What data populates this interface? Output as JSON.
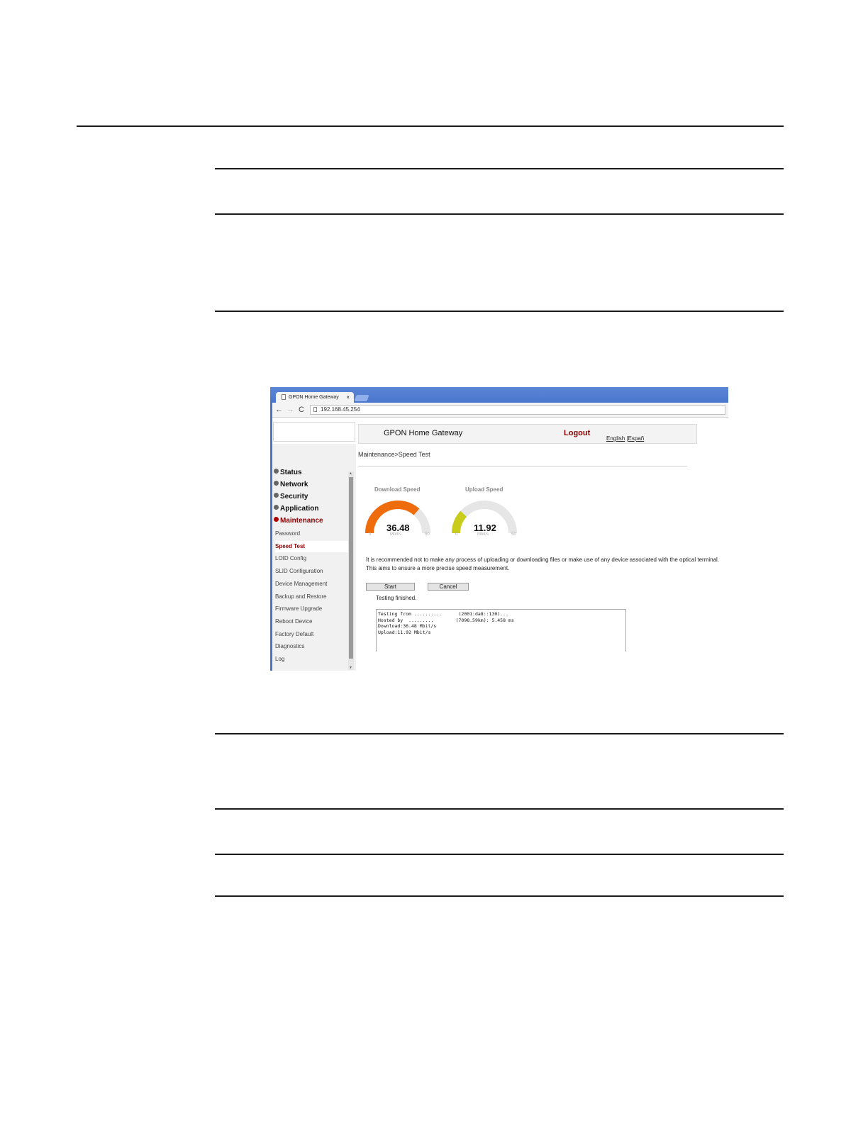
{
  "browser": {
    "tab_title": "GPON Home Gateway",
    "tab_close": "×",
    "url": "192.168.45.254",
    "back": "←",
    "forward": "→",
    "reload": "C"
  },
  "header": {
    "title": "GPON Home Gateway",
    "logout": "Logout",
    "lang_english": "English",
    "lang_separator": " |",
    "lang_spanish": "Españ"
  },
  "breadcrumb": "Maintenance>Speed Test",
  "sidebar": {
    "categories": [
      {
        "label": "Status"
      },
      {
        "label": "Network"
      },
      {
        "label": "Security"
      },
      {
        "label": "Application"
      },
      {
        "label": "Maintenance",
        "active": true
      }
    ],
    "items": [
      {
        "label": "Password"
      },
      {
        "label": "Speed Test",
        "active": true
      },
      {
        "label": "LOID Config"
      },
      {
        "label": "SLID Configuration"
      },
      {
        "label": "Device Management"
      },
      {
        "label": "Backup and Restore"
      },
      {
        "label": "Firmware Upgrade"
      },
      {
        "label": "Reboot Device"
      },
      {
        "label": "Factory Default"
      },
      {
        "label": "Diagnostics"
      },
      {
        "label": "Log"
      }
    ]
  },
  "gauges": {
    "download": {
      "label": "Download Speed",
      "value": "36.48",
      "numeric": 36.48,
      "min": "0",
      "max": "50",
      "unit": "Mbit/s",
      "color": "#ef6c0c"
    },
    "upload": {
      "label": "Upload Speed",
      "value": "11.92",
      "numeric": 11.92,
      "min": "0",
      "max": "50",
      "unit": "Mbit/s",
      "color": "#c9cc1a"
    }
  },
  "notice": {
    "line1": "It is recommended not to make any process of uploading or downloading files or make use of any device associated with the optical terminal.",
    "line2": "This aims to ensure a more precise speed measurement."
  },
  "buttons": {
    "start": "Start",
    "cancel": "Cancel"
  },
  "status": "Testing finished.",
  "results": [
    "Testing from ..........      (2001:da8::130)...",
    "Hosted by  .........        (7098.59km): 5.458 ms",
    "Download:36.48 Mbit/s",
    "Upload:11.92 Mbit/s"
  ],
  "colors": {
    "accent": "#8b0000",
    "chrome": "#4a76cc",
    "gauge_track": "#e6e6e6"
  }
}
